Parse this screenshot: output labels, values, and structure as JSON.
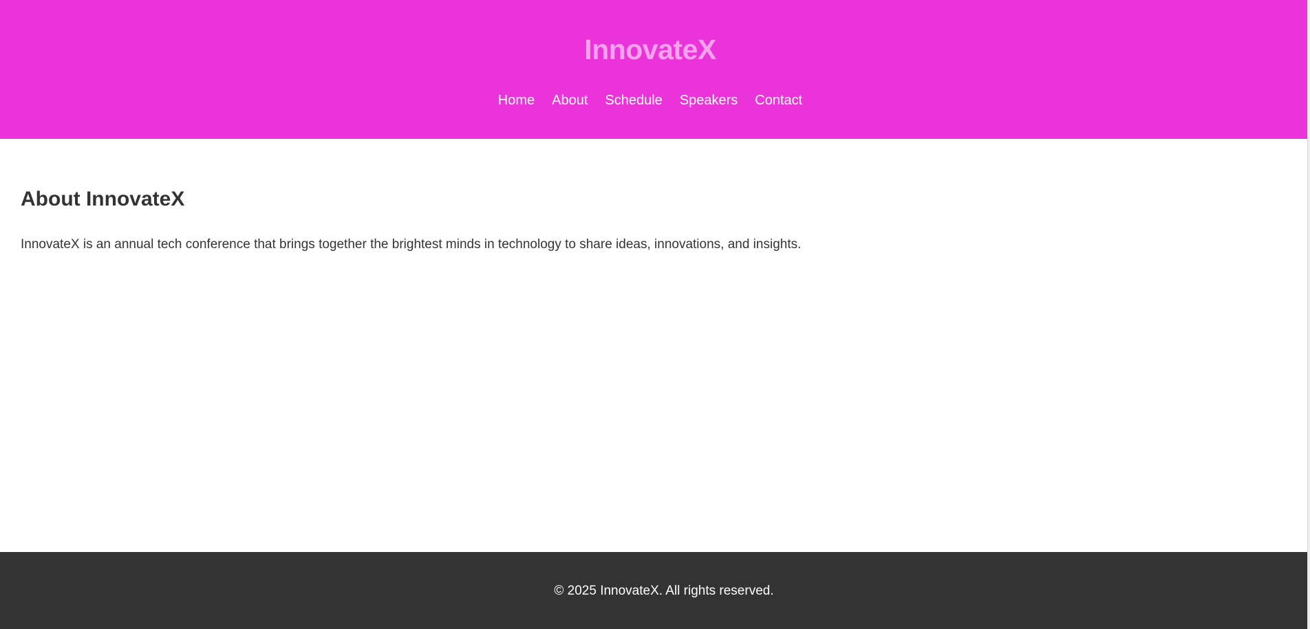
{
  "header": {
    "site_title": "InnovateX",
    "nav": [
      {
        "label": "Home"
      },
      {
        "label": "About"
      },
      {
        "label": "Schedule"
      },
      {
        "label": "Speakers"
      },
      {
        "label": "Contact"
      }
    ]
  },
  "about": {
    "heading": "About InnovateX",
    "text": "InnovateX is an annual tech conference that brings together the brightest minds in technology to share ideas, innovations, and insights."
  },
  "footer": {
    "copyright": "© 2025 InnovateX. All rights reserved."
  },
  "colors": {
    "header_background": "#ea33d8",
    "title_color": "#f4a3ec",
    "footer_background": "#333333",
    "body_text": "#333333"
  }
}
